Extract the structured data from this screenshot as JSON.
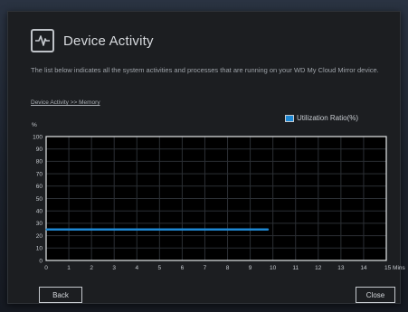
{
  "dialog": {
    "title": "Device Activity",
    "icon": "activity-pulse-icon",
    "description": "The list below indicates all the system activities and processes that are running on your WD My Cloud Mirror device.",
    "breadcrumb": "Device Activity >> Memory"
  },
  "legend": {
    "label": "Utilization Ratio(%)",
    "color": "#1e88d2"
  },
  "chart_data": {
    "type": "line",
    "ylabel": "%",
    "xlabel": "",
    "x_unit": "Mins",
    "ylim": [
      0,
      100
    ],
    "xlim": [
      0,
      15
    ],
    "y_ticks": [
      "100",
      "90",
      "80",
      "70",
      "60",
      "50",
      "40",
      "30",
      "20",
      "10",
      "0"
    ],
    "x_ticks": [
      "0",
      "1",
      "2",
      "3",
      "4",
      "5",
      "6",
      "7",
      "8",
      "9",
      "10",
      "11",
      "12",
      "13",
      "14",
      "15 Mins"
    ],
    "grid": true,
    "series": [
      {
        "name": "Utilization Ratio(%)",
        "color": "#1e88d2",
        "x": [
          0,
          1,
          2,
          3,
          4,
          5,
          6,
          7,
          8,
          9,
          9.8
        ],
        "y": [
          25,
          25,
          25,
          25,
          25,
          25,
          25,
          25,
          25,
          25,
          25
        ]
      }
    ]
  },
  "buttons": {
    "back_label": "Back",
    "close_label": "Close"
  },
  "colors": {
    "accent": "#1e88d2",
    "dialog_bg": "#1c1e21",
    "plot_bg": "#000000",
    "grid": "#2b2f34"
  }
}
